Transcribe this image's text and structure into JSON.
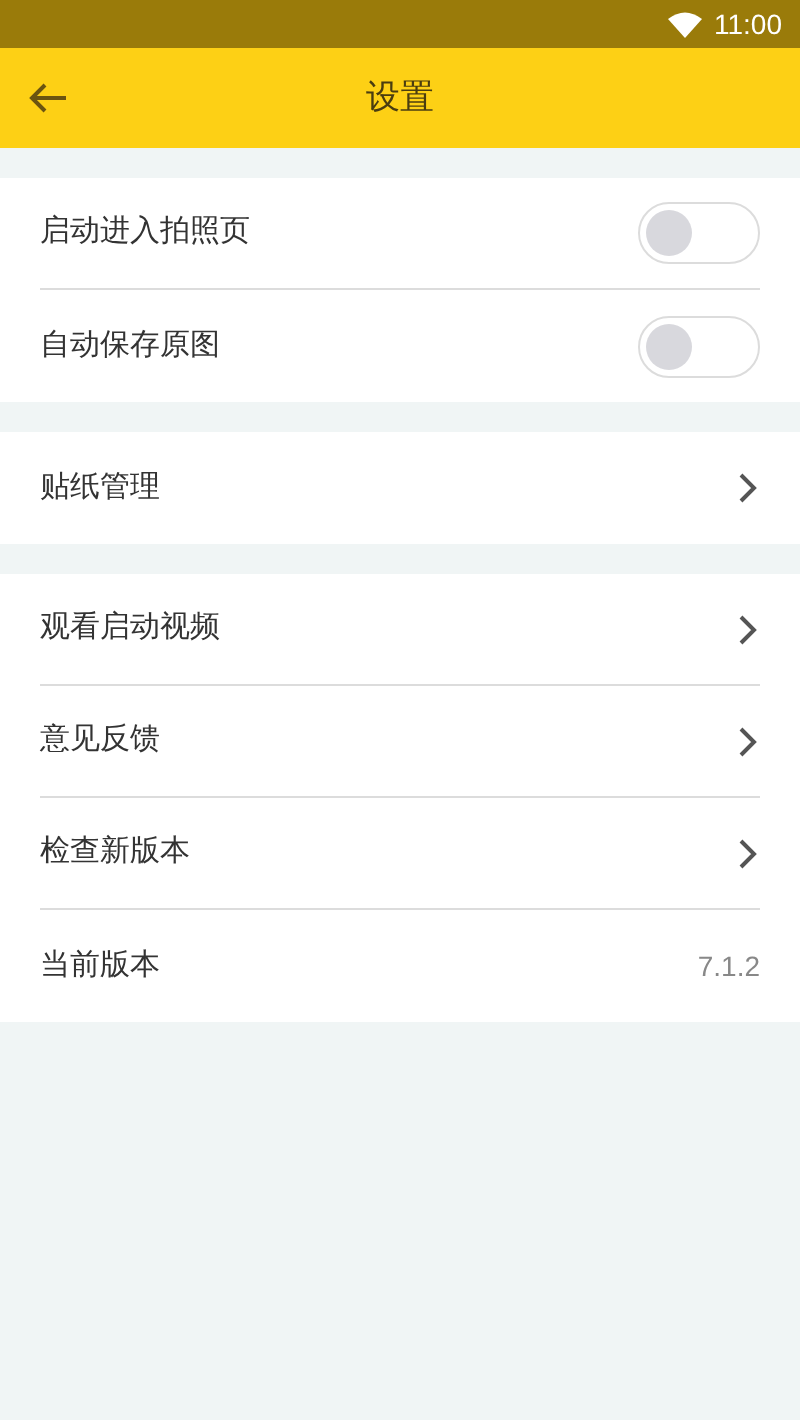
{
  "status_bar": {
    "time": "11:00"
  },
  "toolbar": {
    "title": "设置"
  },
  "sections": [
    {
      "rows": [
        {
          "kind": "toggle",
          "label": "启动进入拍照页",
          "on": false
        },
        {
          "kind": "toggle",
          "label": "自动保存原图",
          "on": false
        }
      ]
    },
    {
      "rows": [
        {
          "kind": "link",
          "label": "贴纸管理"
        }
      ]
    },
    {
      "rows": [
        {
          "kind": "link",
          "label": "观看启动视频"
        },
        {
          "kind": "link",
          "label": "意见反馈"
        },
        {
          "kind": "link",
          "label": "检查新版本"
        },
        {
          "kind": "value",
          "label": "当前版本",
          "value": "7.1.2"
        }
      ]
    }
  ]
}
